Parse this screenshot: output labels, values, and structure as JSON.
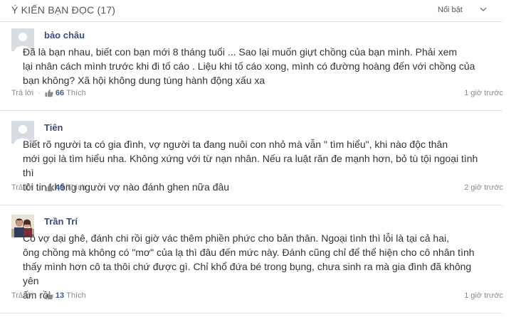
{
  "header": {
    "title": "Ý KIẾN BẠN ĐỌC (17)",
    "sort_label": "Nổi bật"
  },
  "comments": [
    {
      "author": "bảo châu",
      "lines": [
        "Đã là bạn nhau, biết con bạn mới 8 tháng tuổi ... Sao lại muốn giựt chồng của bạn mình. Phải xem",
        "lại nhân cách mình trước khi đi tố cáo . Liệu khi tố cáo xong, mình có đường hoàng đến với chồng của",
        "bạn không? Xã hội không dung túng hành động xấu xa"
      ],
      "reply_label": "Trả lời",
      "likes": "66",
      "like_label": "Thích",
      "time": "1 giờ trước",
      "avatar": "default-avatar"
    },
    {
      "author": "Tiên",
      "lines": [
        "Biết rõ người ta có gia đình, vợ người ta đang nuôi con nhỏ mà vẫn \" tìm hiểu\", khi nào độc thân",
        "mới gọi là tìm hiểu nha. Không xứng với từ nạn nhân. Nếu ra luật răn đe mạnh hơn, bỏ tù tội ngoại tình thì",
        "tôi tin không người vợ nào đánh ghen nữa đâu"
      ],
      "reply_label": "Trả lời",
      "likes": "49",
      "like_label": "Thích",
      "time": "2 giờ trước",
      "avatar": "default-avatar"
    },
    {
      "author": "Trần Trí",
      "lines": [
        "Cô vợ dại ghê, đánh chi rồi giờ vác thêm phiền phức cho bản thân. Ngoại tình thì lỗi là tại cả hai,",
        "ông chồng mà không có \"mơ\" của lạ thì đâu đến mức này. Đánh cũng chỉ để thể hiện cho cô nhân tình",
        "thấy mình hơn cô ta thôi chứ được gì. Chỉ khổ đứa bé trong bụng, chưa sinh ra mà gia đình đã không yên",
        "ấm rồi"
      ],
      "reply_label": "Trả lời",
      "likes": "13",
      "like_label": "Thích",
      "time": "1 giờ trước",
      "avatar": "photo-avatar"
    }
  ],
  "colors": {
    "author": "#3b4a7a",
    "like_count": "#3b5998",
    "meta": "#8d8d8d",
    "text": "#333333"
  },
  "icons": {
    "sort": "chevron-down-icon",
    "like": "thumbs-up-icon",
    "avatar_placeholder": "user-silhouette-icon"
  }
}
